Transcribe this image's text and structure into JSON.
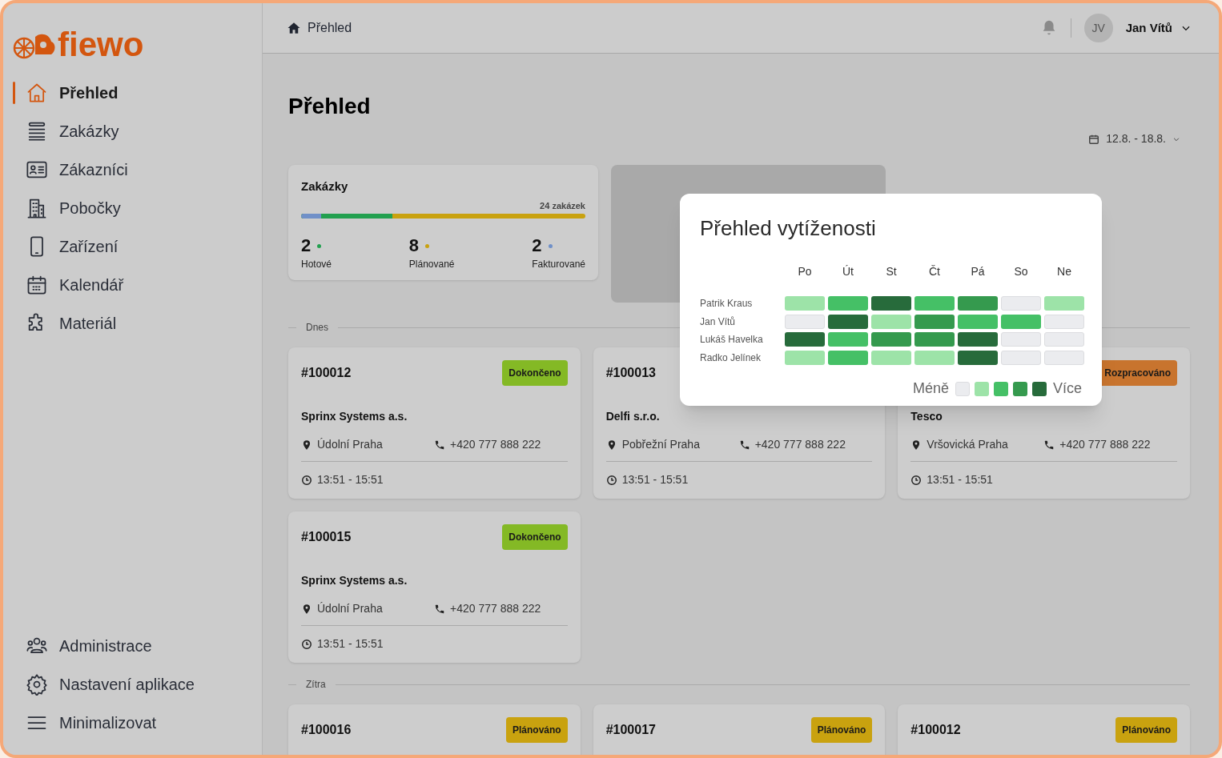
{
  "logo": {
    "text": "fiewo"
  },
  "nav": [
    {
      "label": "Přehled",
      "selected": true
    },
    {
      "label": "Zakázky",
      "selected": false
    },
    {
      "label": "Zákazníci",
      "selected": false
    },
    {
      "label": "Pobočky",
      "selected": false
    },
    {
      "label": "Zařízení",
      "selected": false
    },
    {
      "label": "Kalendář",
      "selected": false
    },
    {
      "label": "Materiál",
      "selected": false
    }
  ],
  "nav_bottom": [
    {
      "label": "Administrace"
    },
    {
      "label": "Nastavení aplikace"
    },
    {
      "label": "Minimalizovat"
    }
  ],
  "header": {
    "breadcrumb": "Přehled",
    "user_initials": "JV",
    "user_name": "Jan Vítů"
  },
  "page_title": "Přehled",
  "date_range": "12.8. - 18.8.",
  "summary": {
    "title": "Zakázky",
    "total": "24 zakázek",
    "segments": [
      {
        "color": "#7090c8",
        "level": 0.07
      },
      {
        "color": "#22a04f",
        "level": 0.32
      },
      {
        "color": "#c9a20f",
        "level": 1
      }
    ],
    "stats": [
      {
        "value": "2",
        "label": "Hotové",
        "color": "#22a04f"
      },
      {
        "value": "8",
        "label": "Plánované",
        "color": "#c9a20f"
      },
      {
        "value": "2",
        "label": "Fakturované",
        "color": "#7090c8"
      }
    ]
  },
  "sections": [
    {
      "label": "Dnes",
      "orders": [
        {
          "id": "#100012",
          "badge": "Dokončeno",
          "color": "#84b925",
          "customer": "Sprinx Systems a.s.",
          "address": "Údolní Praha",
          "phone": "+420 777 888 222",
          "time": "13:51 - 15:51"
        },
        {
          "id": "#100013",
          "customer": "Delfi s.r.o.",
          "address": "Pobřežní Praha",
          "phone": "+420 777 888 222",
          "time": "13:51 - 15:51"
        },
        {
          "badge": "Rozpracováno",
          "color": "#c8742e",
          "customer": "Tesco",
          "address": "Vršovická Praha",
          "phone": "+420 777 888 222",
          "time": "13:51 - 15:51"
        },
        {
          "id": "#100015",
          "badge": "Dokončeno",
          "color": "#84b925",
          "customer": "Sprinx Systems a.s.",
          "address": "Údolní Praha",
          "phone": "+420 777 888 222",
          "time": "13:51 - 15:51"
        }
      ]
    },
    {
      "label": "Zítra",
      "orders": [
        {
          "id": "#100016",
          "badge": "Plánováno",
          "color": "#c9a20f"
        },
        {
          "id": "#100017",
          "badge": "Plánováno",
          "color": "#c9a20f"
        },
        {
          "id": "#100012",
          "badge": "Plánováno",
          "color": "#c9a20f"
        }
      ]
    }
  ],
  "workload": {
    "title": "Přehled vytíženosti",
    "days": [
      "Po",
      "Út",
      "St",
      "Čt",
      "Pá",
      "So",
      "Ne"
    ],
    "rows": [
      {
        "name": "Patrik Kraus",
        "cells": [
          {
            "color": "#9de3a8"
          },
          {
            "color": "#45c066"
          },
          {
            "color": "#276b3b"
          },
          {
            "color": "#45c066"
          },
          {
            "color": "#359a4e"
          },
          {
            "color": "#ebecef"
          },
          {
            "color": "#9de3a8"
          }
        ]
      },
      {
        "name": "Jan Vítů",
        "cells": [
          {
            "color": "#ebecef"
          },
          {
            "color": "#276b3b"
          },
          {
            "color": "#9de3a8"
          },
          {
            "color": "#359a4e"
          },
          {
            "color": "#45c066"
          },
          {
            "color": "#45c066"
          },
          {
            "color": "#ebecef"
          }
        ]
      },
      {
        "name": "Lukáš Havelka",
        "cells": [
          {
            "color": "#276b3b"
          },
          {
            "color": "#45c066"
          },
          {
            "color": "#359a4e"
          },
          {
            "color": "#359a4e"
          },
          {
            "color": "#276b3b"
          },
          {
            "color": "#ebecef"
          },
          {
            "color": "#ebecef"
          }
        ]
      },
      {
        "name": "Radko Jelínek",
        "cells": [
          {
            "color": "#9de3a8"
          },
          {
            "color": "#45c066"
          },
          {
            "color": "#9de3a8"
          },
          {
            "color": "#9de3a8"
          },
          {
            "color": "#276b3b"
          },
          {
            "color": "#ebecef"
          },
          {
            "color": "#ebecef"
          }
        ]
      }
    ],
    "legend_less": "Méně",
    "legend_more": "Více"
  }
}
